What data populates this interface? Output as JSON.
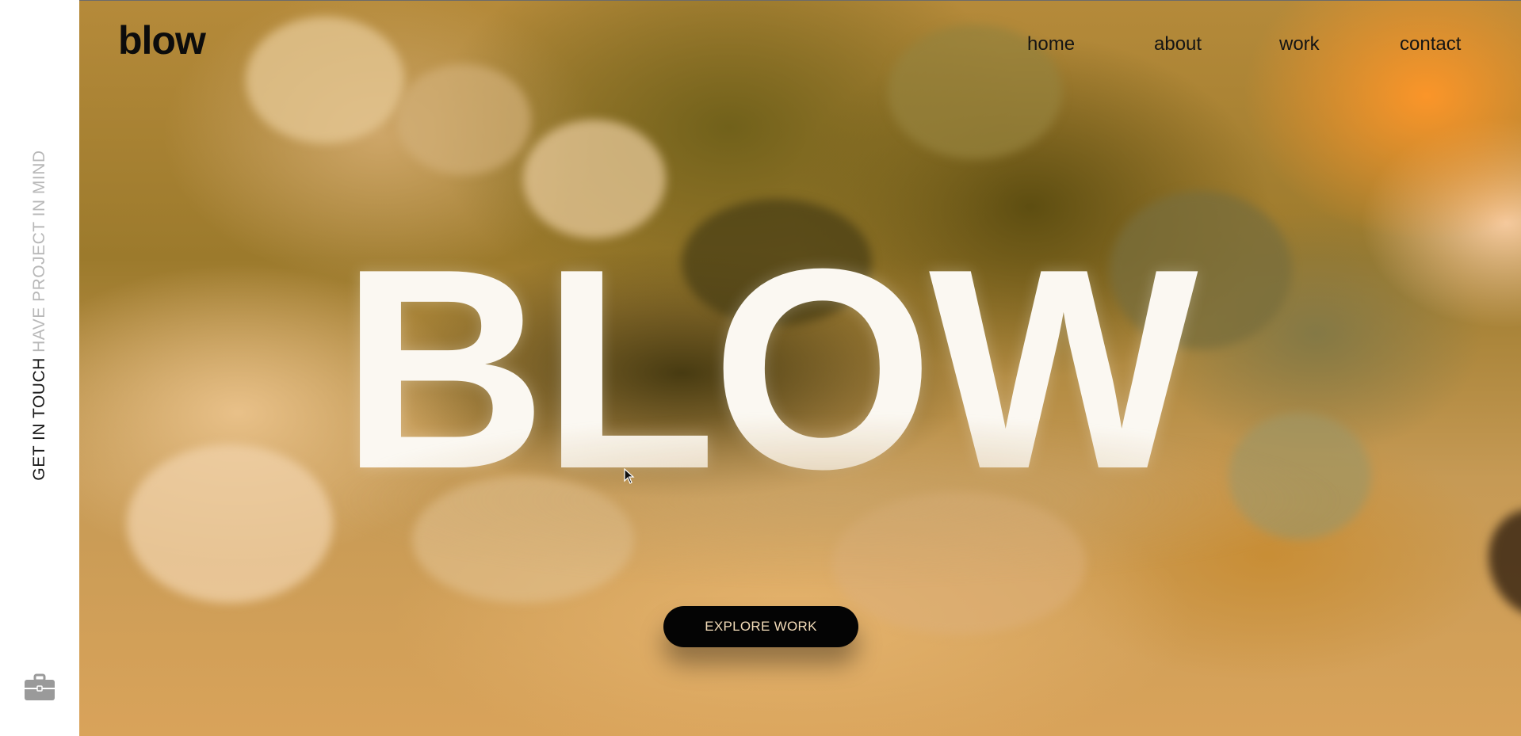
{
  "brand": {
    "logo": "blow"
  },
  "nav": {
    "items": [
      {
        "label": "home"
      },
      {
        "label": "about"
      },
      {
        "label": "work"
      },
      {
        "label": "contact"
      }
    ]
  },
  "sidebar": {
    "cta_strong": "GET IN TOUCH",
    "cta_light": "HAVE PROJECT IN MIND",
    "icon": "briefcase-icon"
  },
  "hero": {
    "headline": "BLOW",
    "button_label": "EXPLORE WORK"
  },
  "colors": {
    "accent_orange": "#ff9a2e",
    "button_bg": "#040404",
    "button_text": "#f3dcb9"
  }
}
